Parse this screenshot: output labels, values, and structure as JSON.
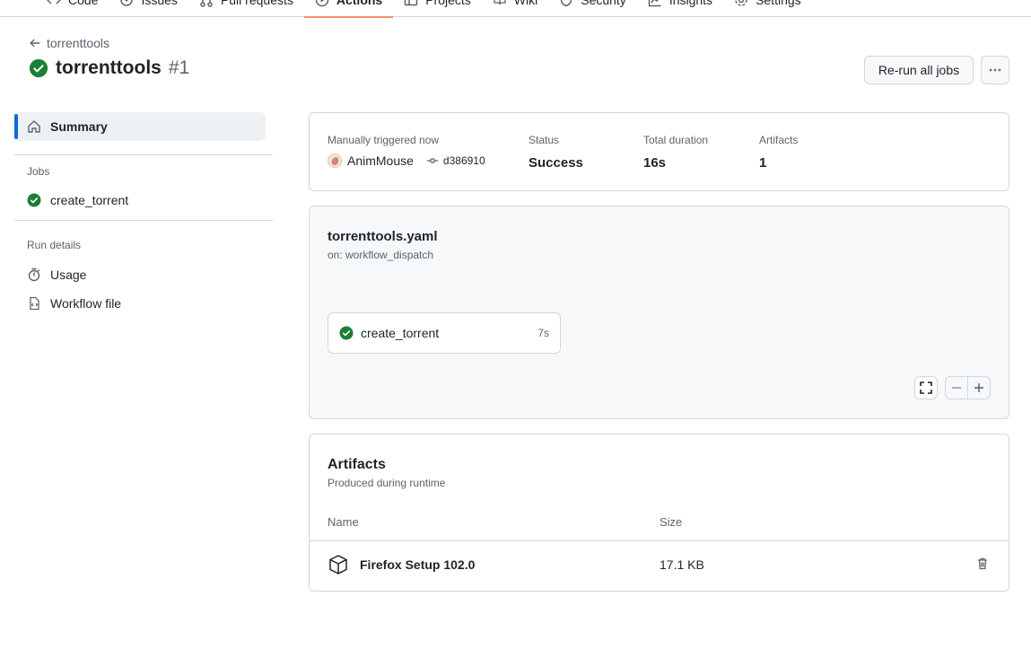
{
  "topnav": {
    "tabs": [
      {
        "label": "Code",
        "icon": "code-icon"
      },
      {
        "label": "Issues",
        "icon": "issue-icon"
      },
      {
        "label": "Pull requests",
        "icon": "pull-request-icon"
      },
      {
        "label": "Actions",
        "icon": "play-icon",
        "active": true
      },
      {
        "label": "Projects",
        "icon": "table-icon"
      },
      {
        "label": "Wiki",
        "icon": "book-icon"
      },
      {
        "label": "Security",
        "icon": "shield-icon"
      },
      {
        "label": "Insights",
        "icon": "graph-icon"
      },
      {
        "label": "Settings",
        "icon": "gear-icon"
      }
    ]
  },
  "header": {
    "back_label": "torrenttools",
    "title": "torrenttools",
    "run_number": "#1",
    "rerun_label": "Re-run all jobs"
  },
  "sidebar": {
    "summary_label": "Summary",
    "jobs_heading": "Jobs",
    "jobs": [
      {
        "label": "create_torrent",
        "status": "success"
      }
    ],
    "run_details_heading": "Run details",
    "details": [
      {
        "label": "Usage",
        "icon": "stopwatch-icon"
      },
      {
        "label": "Workflow file",
        "icon": "file-code-icon"
      }
    ]
  },
  "summary": {
    "trigger_label": "Manually triggered now",
    "actor": "AnimMouse",
    "commit": "d386910",
    "status_label": "Status",
    "status_value": "Success",
    "duration_label": "Total duration",
    "duration_value": "16s",
    "artifacts_label": "Artifacts",
    "artifacts_value": "1"
  },
  "workflow": {
    "name": "torrenttools.yaml",
    "trigger": "on: workflow_dispatch",
    "job": {
      "name": "create_torrent",
      "duration": "7s"
    }
  },
  "artifacts": {
    "title": "Artifacts",
    "subtitle": "Produced during runtime",
    "col_name": "Name",
    "col_size": "Size",
    "rows": [
      {
        "name": "Firefox Setup 102.0",
        "size": "17.1 KB"
      }
    ]
  },
  "colors": {
    "success": "#1a7f37",
    "accent": "#0969da",
    "active_tab": "#fd8c73"
  }
}
